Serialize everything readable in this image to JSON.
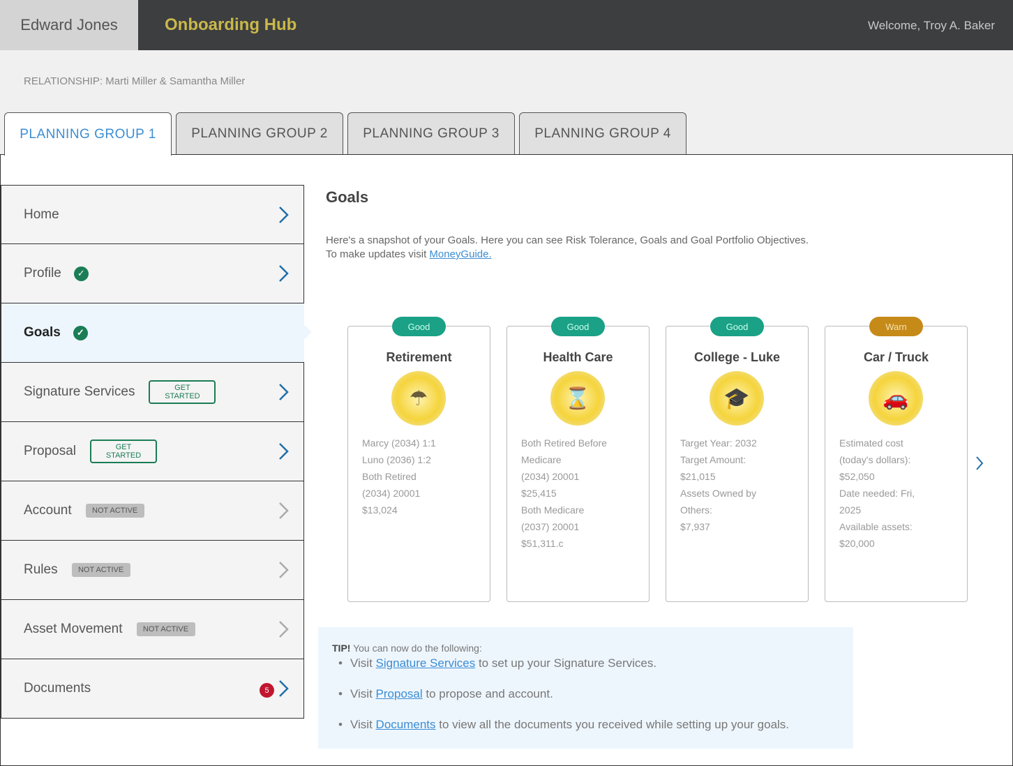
{
  "header": {
    "brand": "Edward Jones",
    "app_title": "Onboarding Hub",
    "welcome": "Welcome, Troy A. Baker"
  },
  "relationship": "RELATIONSHIP: Marti Miller & Samantha Miller",
  "tabs": [
    {
      "label": "PLANNING GROUP 1",
      "active": true
    },
    {
      "label": "PLANNING GROUP 2",
      "active": false
    },
    {
      "label": "PLANNING GROUP 3",
      "active": false
    },
    {
      "label": "PLANNING GROUP 4",
      "active": false
    }
  ],
  "sidenav": {
    "items": [
      {
        "label": "Home"
      },
      {
        "label": "Profile",
        "status": "complete"
      },
      {
        "label": "Goals",
        "status": "complete",
        "active": true
      },
      {
        "label": "Signature Services",
        "pill": "GET STARTED"
      },
      {
        "label": "Proposal",
        "pill": "GET STARTED"
      },
      {
        "label": "Account",
        "pill": "NOT ACTIVE"
      },
      {
        "label": "Rules",
        "pill": "NOT ACTIVE"
      },
      {
        "label": "Asset Movement",
        "pill": "NOT ACTIVE"
      },
      {
        "label": "Documents",
        "count": "5"
      }
    ],
    "check_glyph": "✓"
  },
  "main": {
    "title": "Goals",
    "intro_line1": "Here's a snapshot of your Goals. Here you can see Risk Tolerance, Goals and Goal Portfolio Objectives.",
    "intro_line2_prefix": "To make updates visit ",
    "intro_link": "MoneyGuide."
  },
  "cards": [
    {
      "status": "Good",
      "name": "Retirement",
      "icon": "☂",
      "lines": [
        "Marcy (2034) 1:1",
        "Luno (2036) 1:2",
        "Both Retired",
        "(2034) 20001",
        "$13,024"
      ]
    },
    {
      "status": "Good",
      "name": "Health Care",
      "icon": "⌛",
      "lines": [
        "Both Retired Before",
        "Medicare",
        "(2034) 20001",
        "$25,415",
        "Both Medicare",
        "(2037) 20001",
        "$51,311.c"
      ]
    },
    {
      "status": "Good",
      "name": "College - Luke",
      "icon": "🎓",
      "lines": [
        "Target Year: 2032",
        "Target Amount:",
        "$21,015",
        "Assets Owned by",
        "Others:",
        "$7,937"
      ]
    },
    {
      "status": "Warn",
      "name": "Car / Truck",
      "icon": "🚗",
      "lines": [
        "Estimated cost",
        "(today's dollars):",
        "$52,050",
        "Date needed: Fri,",
        "2025",
        "Available assets:",
        "$20,000"
      ]
    }
  ],
  "tip": {
    "lead": "TIP!",
    "text": " You can now do the following:",
    "items": [
      {
        "prefix": "Visit ",
        "link": "Signature Services",
        "suffix": " to set up your Signature Services."
      },
      {
        "prefix": "Visit ",
        "link": "Proposal",
        "suffix": " to propose and account."
      },
      {
        "prefix": "Visit ",
        "link": "Documents",
        "suffix": " to view all the documents you received while setting up your goals."
      }
    ]
  }
}
